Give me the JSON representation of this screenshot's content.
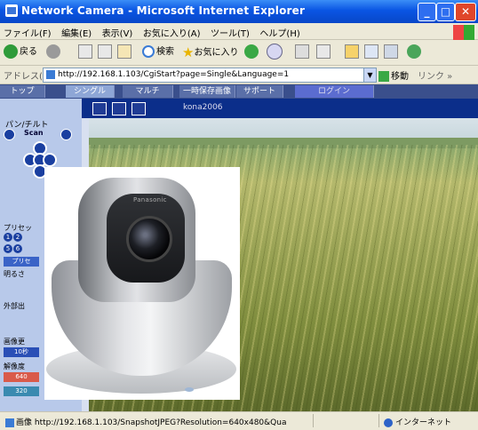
{
  "window": {
    "title": "Network Camera - Microsoft Internet Explorer"
  },
  "menubar": {
    "items": [
      "ファイル(F)",
      "編集(E)",
      "表示(V)",
      "お気に入り(A)",
      "ツール(T)",
      "ヘルプ(H)"
    ]
  },
  "toolbar": {
    "back_label": "戻る",
    "search_label": "検索",
    "favorites_label": "お気に入り"
  },
  "addressbar": {
    "label": "アドレス(D)",
    "url": "http://192.168.1.103/CgiStart?page=Single&Language=1",
    "go_label": "移動",
    "links_label": "リンク"
  },
  "page": {
    "tabs": [
      "トップ",
      "シングル",
      "マルチ",
      "一時保存画像",
      "サポート"
    ],
    "login_label": "ログイン",
    "camera_name": "kona2006",
    "pan_tilt_label": "パン/チルト",
    "scan_label": "Scan",
    "preset_label": "プリセッ",
    "preset_button_label": "プリセ",
    "brightness_label": "明るさ",
    "external_output_label": "外部出",
    "refresh_label": "画像更",
    "refresh_value": "10秒",
    "resolution_label": "解像度",
    "resolution_a": "640",
    "resolution_b": "320",
    "preset_numbers": [
      "1",
      "2",
      "5",
      "6"
    ],
    "overlay_brand": "Panasonic"
  },
  "statusbar": {
    "text": "画像 http://192.168.1.103/SnapshotJPEG?Resolution=640x480&Qua",
    "zone": "インターネット"
  }
}
